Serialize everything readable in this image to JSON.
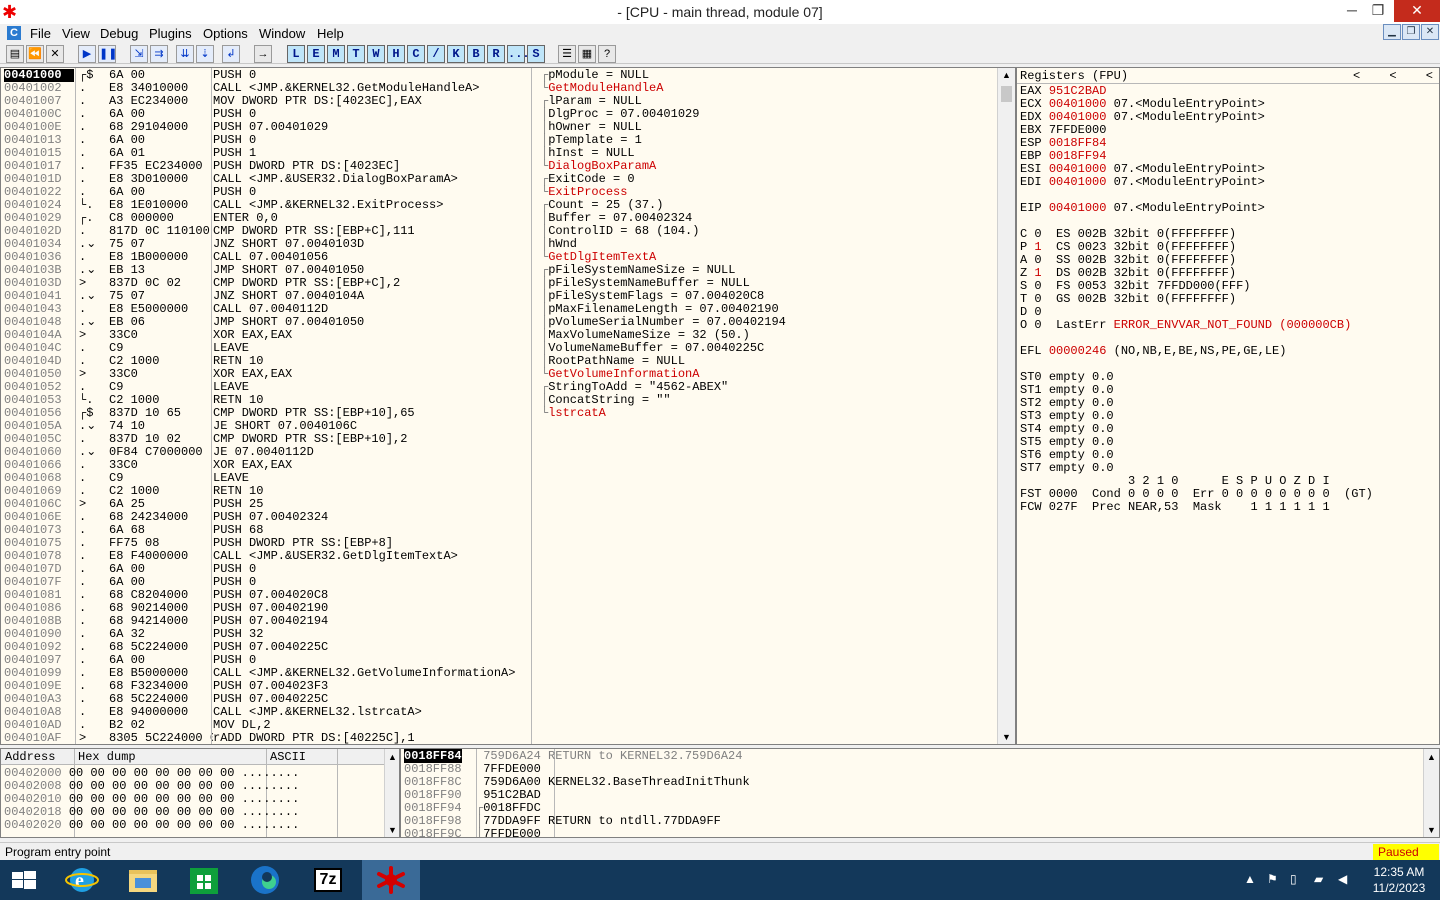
{
  "window": {
    "title": "- [CPU - main thread, module 07]",
    "min": "─",
    "max": "❐",
    "close": "✕"
  },
  "menu": [
    "File",
    "View",
    "Debug",
    "Plugins",
    "Options",
    "Window",
    "Help"
  ],
  "toolbar": {
    "letters": [
      "L",
      "E",
      "M",
      "T",
      "W",
      "H",
      "C",
      "/",
      "K",
      "B",
      "R",
      "...",
      "S"
    ]
  },
  "cpu": {
    "rows": [
      {
        "addr": "00401000",
        "mark": "r$",
        "hex": "6A 00",
        "asm": "PUSH 0",
        "cmt": "pModule = NULL",
        "cb": "r",
        "selected": true
      },
      {
        "addr": "00401002",
        "mark": ".",
        "hex": "E8 34010000",
        "asm": "CALL <JMP.&KERNEL32.GetModuleHandleA>",
        "cmt": "GetModuleHandleA",
        "cb": "l",
        "api": true
      },
      {
        "addr": "00401007",
        "mark": ".",
        "hex": "A3 EC234000",
        "asm": "MOV DWORD PTR DS:[4023EC],EAX",
        "cmt": ""
      },
      {
        "addr": "0040100C",
        "mark": ".",
        "hex": "6A 00",
        "asm": "PUSH 0",
        "cmt": "lParam = NULL",
        "cb": "r"
      },
      {
        "addr": "0040100E",
        "mark": ".",
        "hex": "68 29104000",
        "asm": "PUSH 07.00401029",
        "cmt": "DlgProc = 07.00401029",
        "cb": "|"
      },
      {
        "addr": "00401013",
        "mark": ".",
        "hex": "6A 00",
        "asm": "PUSH 0",
        "cmt": "hOwner = NULL",
        "cb": "|"
      },
      {
        "addr": "00401015",
        "mark": ".",
        "hex": "6A 01",
        "asm": "PUSH 1",
        "cmt": "pTemplate = 1",
        "cb": "|"
      },
      {
        "addr": "00401017",
        "mark": ".",
        "hex": "FF35 EC234000",
        "asm": "PUSH DWORD PTR DS:[4023EC]",
        "cmt": "hInst = NULL",
        "cb": "|"
      },
      {
        "addr": "0040101D",
        "mark": ".",
        "hex": "E8 3D010000",
        "asm": "CALL <JMP.&USER32.DialogBoxParamA>",
        "cmt": "DialogBoxParamA",
        "cb": "l",
        "api": true
      },
      {
        "addr": "00401022",
        "mark": ".",
        "hex": "6A 00",
        "asm": "PUSH 0",
        "cmt": "ExitCode = 0",
        "cb": "r"
      },
      {
        "addr": "00401024",
        "mark": "L.",
        "hex": "E8 1E010000",
        "asm": "CALL <JMP.&KERNEL32.ExitProcess>",
        "cmt": "ExitProcess",
        "cb": "l",
        "api": true
      },
      {
        "addr": "00401029",
        "mark": "r.",
        "hex": "C8 000000",
        "asm": "ENTER 0,0",
        "cmt": ""
      },
      {
        "addr": "0040102D",
        "mark": ".",
        "hex": "817D 0C 110100",
        "asm": "CMP DWORD PTR SS:[EBP+C],111",
        "cmt": ""
      },
      {
        "addr": "00401034",
        "mark": ".v",
        "hex": "75 07",
        "asm": "JNZ SHORT 07.0040103D",
        "cmt": ""
      },
      {
        "addr": "00401036",
        "mark": ".",
        "hex": "E8 1B000000",
        "asm": "CALL 07.00401056",
        "cmt": ""
      },
      {
        "addr": "0040103B",
        "mark": ".v",
        "hex": "EB 13",
        "asm": "JMP SHORT 07.00401050",
        "cmt": ""
      },
      {
        "addr": "0040103D",
        "mark": ">",
        "hex": "837D 0C 02",
        "asm": "CMP DWORD PTR SS:[EBP+C],2",
        "cmt": ""
      },
      {
        "addr": "00401041",
        "mark": ".v",
        "hex": "75 07",
        "asm": "JNZ SHORT 07.0040104A",
        "cmt": ""
      },
      {
        "addr": "00401043",
        "mark": ".",
        "hex": "E8 E5000000",
        "asm": "CALL 07.0040112D",
        "cmt": ""
      },
      {
        "addr": "00401048",
        "mark": ".v",
        "hex": "EB 06",
        "asm": "JMP SHORT 07.00401050",
        "cmt": ""
      },
      {
        "addr": "0040104A",
        "mark": ">",
        "hex": "33C0",
        "asm": "XOR EAX,EAX",
        "cmt": ""
      },
      {
        "addr": "0040104C",
        "mark": ".",
        "hex": "C9",
        "asm": "LEAVE",
        "cmt": ""
      },
      {
        "addr": "0040104D",
        "mark": ".",
        "hex": "C2 1000",
        "asm": "RETN 10",
        "cmt": ""
      },
      {
        "addr": "00401050",
        "mark": ">",
        "hex": "33C0",
        "asm": "XOR EAX,EAX",
        "cmt": ""
      },
      {
        "addr": "00401052",
        "mark": ".",
        "hex": "C9",
        "asm": "LEAVE",
        "cmt": ""
      },
      {
        "addr": "00401053",
        "mark": "L.",
        "hex": "C2 1000",
        "asm": "RETN 10",
        "cmt": ""
      },
      {
        "addr": "00401056",
        "mark": "r$",
        "hex": "837D 10 65",
        "asm": "CMP DWORD PTR SS:[EBP+10],65",
        "cmt": ""
      },
      {
        "addr": "0040105A",
        "mark": ".v",
        "hex": "74 10",
        "asm": "JE SHORT 07.0040106C",
        "cmt": ""
      },
      {
        "addr": "0040105C",
        "mark": ".",
        "hex": "837D 10 02",
        "asm": "CMP DWORD PTR SS:[EBP+10],2",
        "cmt": ""
      },
      {
        "addr": "00401060",
        "mark": ".v",
        "hex": "0F84 C7000000",
        "asm": "JE 07.0040112D",
        "cmt": ""
      },
      {
        "addr": "00401066",
        "mark": ".",
        "hex": "33C0",
        "asm": "XOR EAX,EAX",
        "cmt": ""
      },
      {
        "addr": "00401068",
        "mark": ".",
        "hex": "C9",
        "asm": "LEAVE",
        "cmt": ""
      },
      {
        "addr": "00401069",
        "mark": ".",
        "hex": "C2 1000",
        "asm": "RETN 10",
        "cmt": ""
      },
      {
        "addr": "0040106C",
        "mark": ">",
        "hex": "6A 25",
        "asm": "PUSH 25",
        "cmt": "Count = 25 (37.)",
        "cb": "r"
      },
      {
        "addr": "0040106E",
        "mark": ".",
        "hex": "68 24234000",
        "asm": "PUSH 07.00402324",
        "cmt": "Buffer = 07.00402324",
        "cb": "|"
      },
      {
        "addr": "00401073",
        "mark": ".",
        "hex": "6A 68",
        "asm": "PUSH 68",
        "cmt": "ControlID = 68 (104.)",
        "cb": "|"
      },
      {
        "addr": "00401075",
        "mark": ".",
        "hex": "FF75 08",
        "asm": "PUSH DWORD PTR SS:[EBP+8]",
        "cmt": "hWnd",
        "cb": "|"
      },
      {
        "addr": "00401078",
        "mark": ".",
        "hex": "E8 F4000000",
        "asm": "CALL <JMP.&USER32.GetDlgItemTextA>",
        "cmt": "GetDlgItemTextA",
        "cb": "l",
        "api": true
      },
      {
        "addr": "0040107D",
        "mark": ".",
        "hex": "6A 00",
        "asm": "PUSH 0",
        "cmt": "pFileSystemNameSize = NULL",
        "cb": "r"
      },
      {
        "addr": "0040107F",
        "mark": ".",
        "hex": "6A 00",
        "asm": "PUSH 0",
        "cmt": "pFileSystemNameBuffer = NULL",
        "cb": "|"
      },
      {
        "addr": "00401081",
        "mark": ".",
        "hex": "68 C8204000",
        "asm": "PUSH 07.004020C8",
        "cmt": "pFileSystemFlags = 07.004020C8",
        "cb": "|"
      },
      {
        "addr": "00401086",
        "mark": ".",
        "hex": "68 90214000",
        "asm": "PUSH 07.00402190",
        "cmt": "pMaxFilenameLength = 07.00402190",
        "cb": "|"
      },
      {
        "addr": "0040108B",
        "mark": ".",
        "hex": "68 94214000",
        "asm": "PUSH 07.00402194",
        "cmt": "pVolumeSerialNumber = 07.00402194",
        "cb": "|"
      },
      {
        "addr": "00401090",
        "mark": ".",
        "hex": "6A 32",
        "asm": "PUSH 32",
        "cmt": "MaxVolumeNameSize = 32 (50.)",
        "cb": "|"
      },
      {
        "addr": "00401092",
        "mark": ".",
        "hex": "68 5C224000",
        "asm": "PUSH 07.0040225C",
        "cmt": "VolumeNameBuffer = 07.0040225C",
        "cb": "|"
      },
      {
        "addr": "00401097",
        "mark": ".",
        "hex": "6A 00",
        "asm": "PUSH 0",
        "cmt": "RootPathName = NULL",
        "cb": "|"
      },
      {
        "addr": "00401099",
        "mark": ".",
        "hex": "E8 B5000000",
        "asm": "CALL <JMP.&KERNEL32.GetVolumeInformationA>",
        "cmt": "GetVolumeInformationA",
        "cb": "l",
        "api": true
      },
      {
        "addr": "0040109E",
        "mark": ".",
        "hex": "68 F3234000",
        "asm": "PUSH 07.004023F3",
        "cmt": "StringToAdd = \"4562-ABEX\"",
        "cb": "r"
      },
      {
        "addr": "004010A3",
        "mark": ".",
        "hex": "68 5C224000",
        "asm": "PUSH 07.0040225C",
        "cmt": "ConcatString = \"\"",
        "cb": "|"
      },
      {
        "addr": "004010A8",
        "mark": ".",
        "hex": "E8 94000000",
        "asm": "CALL <JMP.&KERNEL32.lstrcatA>",
        "cmt": "lstrcatA",
        "cb": "l",
        "api": true
      },
      {
        "addr": "004010AD",
        "mark": ".",
        "hex": "B2 02",
        "asm": "MOV DL,2",
        "cmt": ""
      },
      {
        "addr": "004010AF",
        "mark": ">",
        "hex": "8305 5C224000 01",
        "asm": "rADD DWORD PTR DS:[40225C],1",
        "cmt": ""
      }
    ]
  },
  "registers": {
    "title": "Registers (FPU)",
    "arrows": [
      "<",
      "<",
      "<"
    ],
    "gp": [
      {
        "name": "EAX",
        "value": "951C2BAD",
        "changed": true,
        "info": ""
      },
      {
        "name": "ECX",
        "value": "00401000",
        "changed": true,
        "info": "07.<ModuleEntryPoint>"
      },
      {
        "name": "EDX",
        "value": "00401000",
        "changed": true,
        "info": "07.<ModuleEntryPoint>"
      },
      {
        "name": "EBX",
        "value": "7FFDE000",
        "changed": false,
        "info": ""
      },
      {
        "name": "ESP",
        "value": "0018FF84",
        "changed": true,
        "info": ""
      },
      {
        "name": "EBP",
        "value": "0018FF94",
        "changed": true,
        "info": ""
      },
      {
        "name": "ESI",
        "value": "00401000",
        "changed": true,
        "info": "07.<ModuleEntryPoint>"
      },
      {
        "name": "EDI",
        "value": "00401000",
        "changed": true,
        "info": "07.<ModuleEntryPoint>"
      }
    ],
    "eip": {
      "name": "EIP",
      "value": "00401000",
      "changed": true,
      "info": "07.<ModuleEntryPoint>"
    },
    "flags": [
      {
        "flag": "C",
        "val": "0",
        "changed": false,
        "seg": "ES",
        "sel": "002B",
        "bits": "32bit",
        "base": "0(FFFFFFFF)"
      },
      {
        "flag": "P",
        "val": "1",
        "changed": true,
        "seg": "CS",
        "sel": "0023",
        "bits": "32bit",
        "base": "0(FFFFFFFF)"
      },
      {
        "flag": "A",
        "val": "0",
        "changed": false,
        "seg": "SS",
        "sel": "002B",
        "bits": "32bit",
        "base": "0(FFFFFFFF)"
      },
      {
        "flag": "Z",
        "val": "1",
        "changed": true,
        "seg": "DS",
        "sel": "002B",
        "bits": "32bit",
        "base": "0(FFFFFFFF)"
      },
      {
        "flag": "S",
        "val": "0",
        "changed": false,
        "seg": "FS",
        "sel": "0053",
        "bits": "32bit",
        "base": "7FFDD000(FFF)"
      },
      {
        "flag": "T",
        "val": "0",
        "changed": false,
        "seg": "GS",
        "sel": "002B",
        "bits": "32bit",
        "base": "0(FFFFFFFF)"
      },
      {
        "flag": "D",
        "val": "0",
        "changed": false,
        "seg": "",
        "sel": "",
        "bits": "",
        "base": ""
      }
    ],
    "lasterr": {
      "flag": "O",
      "val": "0",
      "label": "LastErr",
      "value": "ERROR_ENVVAR_NOT_FOUND (000000CB)"
    },
    "efl": {
      "name": "EFL",
      "value": "00000246",
      "info": "(NO,NB,E,BE,NS,PE,GE,LE)"
    },
    "fpu": [
      {
        "name": "ST0",
        "state": "empty",
        "value": "0.0"
      },
      {
        "name": "ST1",
        "state": "empty",
        "value": "0.0"
      },
      {
        "name": "ST2",
        "state": "empty",
        "value": "0.0"
      },
      {
        "name": "ST3",
        "state": "empty",
        "value": "0.0"
      },
      {
        "name": "ST4",
        "state": "empty",
        "value": "0.0"
      },
      {
        "name": "ST5",
        "state": "empty",
        "value": "0.0"
      },
      {
        "name": "ST6",
        "state": "empty",
        "value": "0.0"
      },
      {
        "name": "ST7",
        "state": "empty",
        "value": "0.0"
      }
    ],
    "fpu_header": "               3 2 1 0      E S P U O Z D I",
    "fst": "FST 0000  Cond 0 0 0 0  Err 0 0 0 0 0 0 0 0  (GT)",
    "fcw": "FCW 027F  Prec NEAR,53  Mask    1 1 1 1 1 1"
  },
  "dump": {
    "headers": [
      "Address",
      "Hex dump",
      "ASCII"
    ],
    "rows": [
      {
        "addr": "00402000",
        "hex": "00 00 00 00 00 00 00 00",
        "ascii": "........"
      },
      {
        "addr": "00402008",
        "hex": "00 00 00 00 00 00 00 00",
        "ascii": "........"
      },
      {
        "addr": "00402010",
        "hex": "00 00 00 00 00 00 00 00",
        "ascii": "........"
      },
      {
        "addr": "00402018",
        "hex": "00 00 00 00 00 00 00 00",
        "ascii": "........"
      },
      {
        "addr": "00402020",
        "hex": "00 00 00 00 00 00 00 00",
        "ascii": "........"
      }
    ]
  },
  "stack": {
    "rows": [
      {
        "addr": "0018FF84",
        "mark": "",
        "value": "759D6A24",
        "cmt": "RETURN to KERNEL32.759D6A24",
        "top": true
      },
      {
        "addr": "0018FF88",
        "mark": "",
        "value": "7FFDE000",
        "cmt": ""
      },
      {
        "addr": "0018FF8C",
        "mark": "",
        "value": "759D6A00",
        "cmt": "KERNEL32.BaseThreadInitThunk"
      },
      {
        "addr": "0018FF90",
        "mark": "",
        "value": "951C2BAD",
        "cmt": ""
      },
      {
        "addr": "0018FF94",
        "mark": "r",
        "value": "0018FFDC",
        "cmt": ""
      },
      {
        "addr": "0018FF98",
        "mark": "|",
        "value": "77DDA9FF",
        "cmt": "RETURN to ntdll.77DDA9FF"
      },
      {
        "addr": "0018FF9C",
        "mark": "|",
        "value": "7FFDE000",
        "cmt": ""
      }
    ]
  },
  "status": {
    "text": "Program entry point",
    "state": "Paused"
  },
  "taskbar": {
    "apps": [
      "start-icon",
      "ie-icon",
      "explorer-icon",
      "store-icon",
      "edge-icon",
      "7zip-icon",
      "ollydbg-icon"
    ],
    "time": "12:35 AM",
    "date": "11/2/2023",
    "sevenzip": "7z"
  },
  "colors": {
    "accent": "#cc0000",
    "pane_bg": "#fffbf0",
    "taskbar": "#13385a",
    "paused_bg": "#ffff00"
  }
}
